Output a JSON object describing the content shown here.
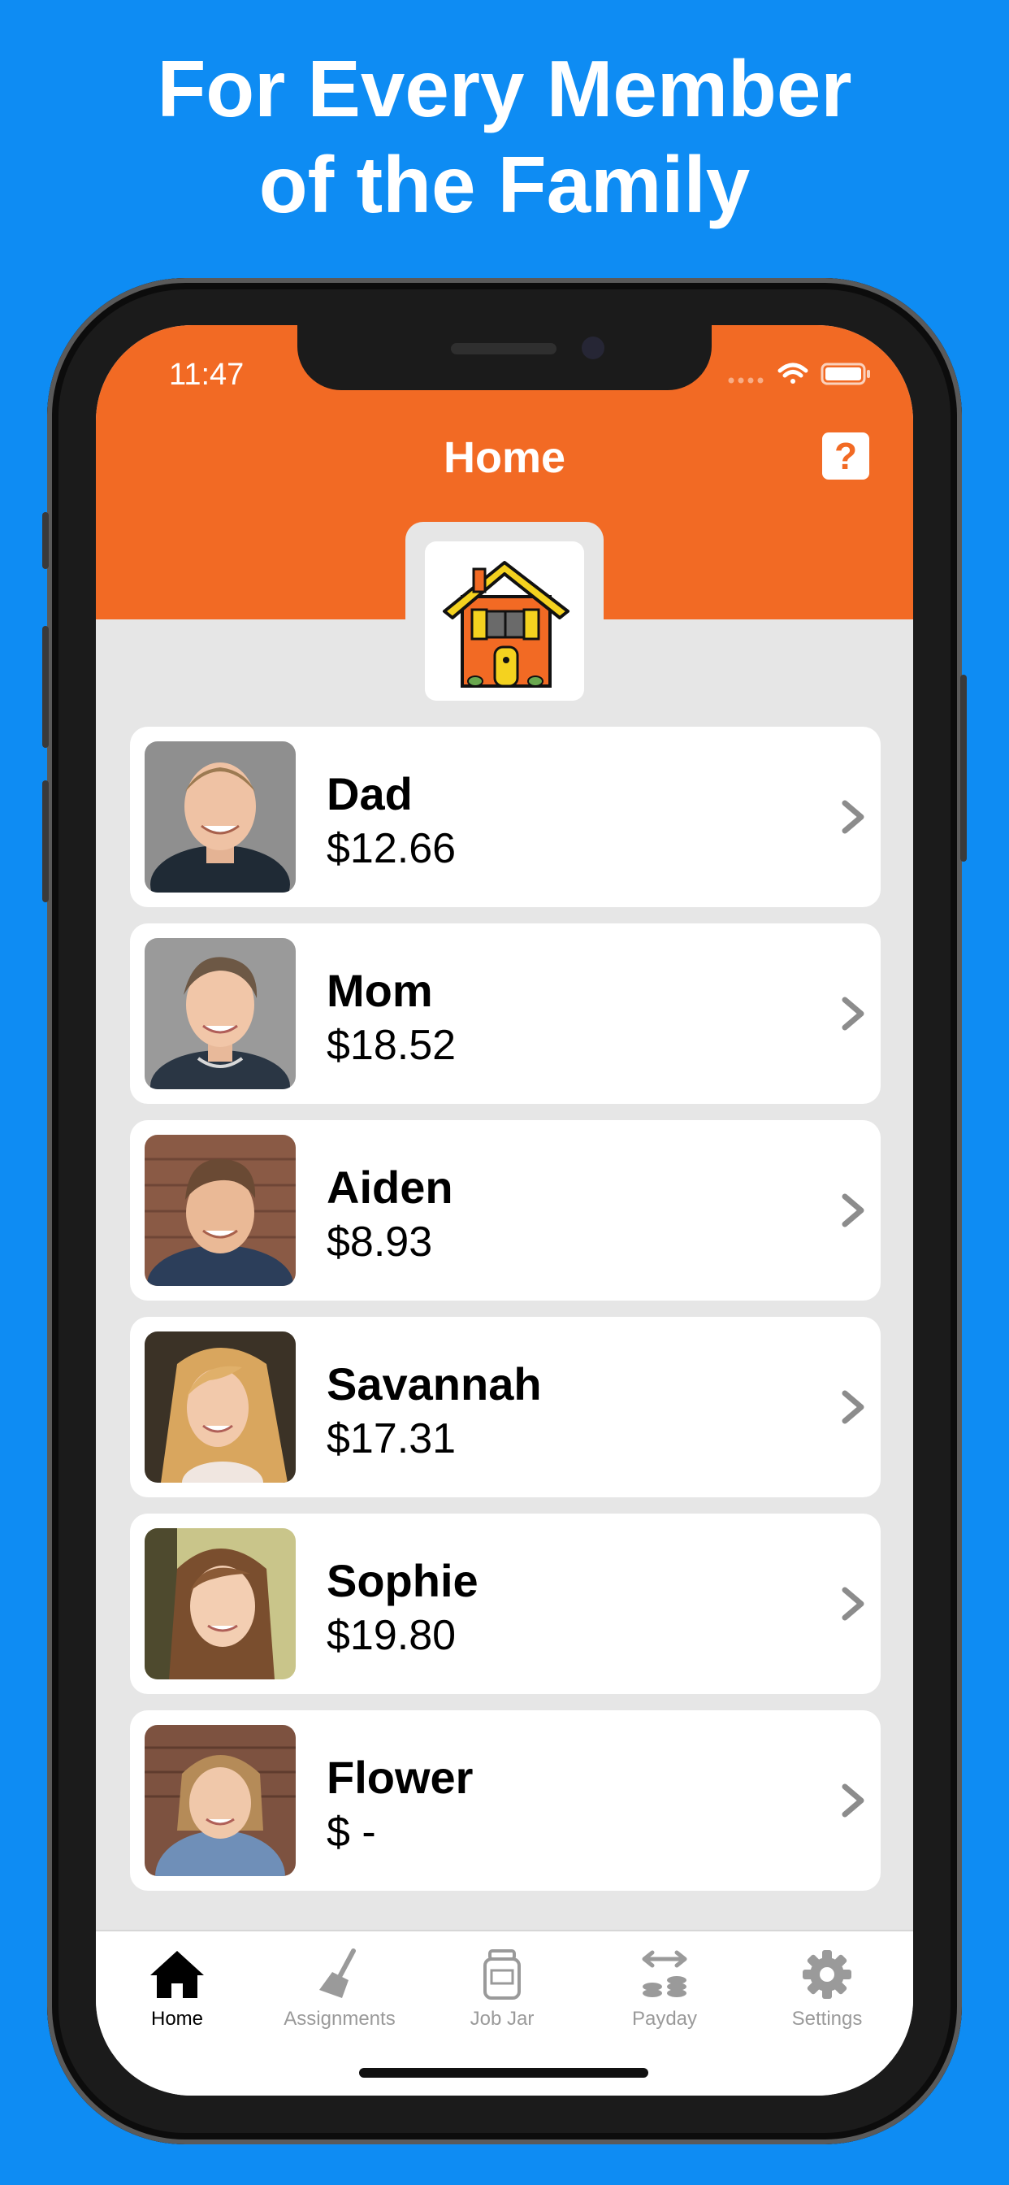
{
  "promo": {
    "headline_line1": "For Every Member",
    "headline_line2": "of the Family"
  },
  "status_bar": {
    "time": "11:47"
  },
  "header": {
    "title": "Home",
    "help_label": "?"
  },
  "members": [
    {
      "name": "Dad",
      "amount": "$12.66"
    },
    {
      "name": "Mom",
      "amount": "$18.52"
    },
    {
      "name": "Aiden",
      "amount": "$8.93"
    },
    {
      "name": "Savannah",
      "amount": "$17.31"
    },
    {
      "name": "Sophie",
      "amount": "$19.80"
    },
    {
      "name": "Flower",
      "amount": "$ -"
    }
  ],
  "tabbar": {
    "tabs": [
      {
        "label": "Home",
        "icon": "home-icon",
        "active": true
      },
      {
        "label": "Assignments",
        "icon": "broom-icon",
        "active": false
      },
      {
        "label": "Job Jar",
        "icon": "jar-icon",
        "active": false
      },
      {
        "label": "Payday",
        "icon": "coins-transfer-icon",
        "active": false
      },
      {
        "label": "Settings",
        "icon": "gear-icon",
        "active": false
      }
    ]
  },
  "colors": {
    "background": "#0E8CF3",
    "header": "#F26A24",
    "content": "#E6E6E6"
  }
}
